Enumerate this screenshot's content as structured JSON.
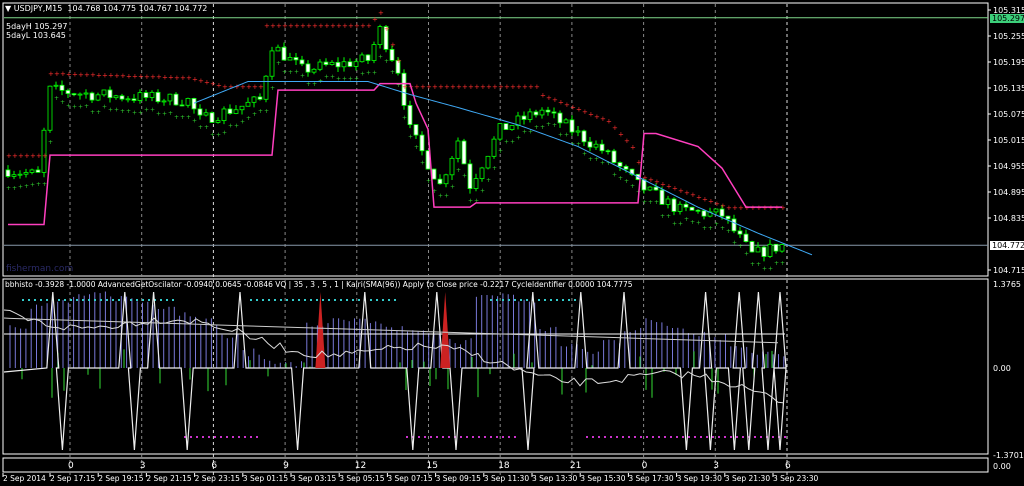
{
  "header": {
    "symbol": "USDJPY,M15",
    "ohlc": "104.768 104.775 104.767 104.772",
    "day_high": "5dayH 105.297",
    "day_low": "5dayL 103.645",
    "watermark": "fisherman.com"
  },
  "indicator_header": "bbhisto -0.3928 -1.0000  AdvancedGetOscilator -0.0940 0.0645 -0.0846  VQ | 35 , 3 , 5 , 1 |  Kairi(SMA(96)) Apply to Close price -0.2217  CycleIdentifier 0.0000 104.7775",
  "price_axis": [
    "105.315",
    "105.255",
    "105.195",
    "105.135",
    "105.075",
    "105.015",
    "104.955",
    "104.895",
    "104.835",
    "104.715"
  ],
  "price_axis_values": [
    105.315,
    105.255,
    105.195,
    105.135,
    105.075,
    105.015,
    104.955,
    104.895,
    104.835,
    104.715
  ],
  "price_tags": {
    "high": "105.297",
    "high_value": 105.297,
    "current": "104.772",
    "current_value": 104.772
  },
  "indicator_axis": {
    "top": "1.3765",
    "zero": "0.00",
    "bottom": "-1.3701",
    "cycle_scale": "0.00"
  },
  "cycle_labels": [
    "0",
    "3",
    "6",
    "9",
    "12",
    "15",
    "18",
    "21",
    "0",
    "3",
    "6"
  ],
  "time_labels": [
    "2 Sep 2014",
    "2 Sep 17:15",
    "2 Sep 19:15",
    "2 Sep 21:15",
    "2 Sep 23:15",
    "3 Sep 01:15",
    "3 Sep 03:15",
    "3 Sep 05:15",
    "3 Sep 07:15",
    "3 Sep 09:15",
    "3 Sep 11:30",
    "3 Sep 13:30",
    "3 Sep 15:30",
    "3 Sep 17:30",
    "3 Sep 19:30",
    "3 Sep 21:30",
    "3 Sep 23:30"
  ],
  "colors": {
    "bull": "#00ff00",
    "bear": "#ffffff",
    "wick": "#00ff00",
    "pink": "#ff3fbf",
    "ma": "#3fa9f5",
    "high_line": "#7fd88a",
    "hist": "#7878d8",
    "cyan": "#33cccc",
    "magenta": "#cc33cc",
    "spike_red": "#cc2222"
  },
  "price_path": [
    [
      0,
      104.946
    ],
    [
      5,
      104.934
    ],
    [
      7,
      105.13
    ],
    [
      15,
      105.119
    ],
    [
      30,
      105.107
    ],
    [
      32,
      105.061
    ],
    [
      42,
      105.107
    ],
    [
      44,
      105.234
    ],
    [
      49,
      105.177
    ],
    [
      60,
      105.2
    ],
    [
      62,
      105.269
    ],
    [
      65,
      105.177
    ],
    [
      67,
      105.038
    ],
    [
      72,
      104.911
    ],
    [
      75,
      105.015
    ],
    [
      77,
      104.911
    ],
    [
      82,
      105.038
    ],
    [
      89,
      105.084
    ],
    [
      99,
      104.992
    ],
    [
      105,
      104.911
    ],
    [
      112,
      104.853
    ],
    [
      119,
      104.842
    ],
    [
      124,
      104.75
    ],
    [
      129,
      104.772
    ]
  ],
  "upper_band": [
    [
      0,
      104.98
    ],
    [
      6,
      104.98
    ],
    [
      7,
      105.17
    ],
    [
      30,
      105.16
    ],
    [
      36,
      105.14
    ],
    [
      42,
      105.14
    ],
    [
      43,
      105.28
    ],
    [
      60,
      105.28
    ],
    [
      62,
      105.31
    ],
    [
      65,
      105.2
    ],
    [
      66,
      105.14
    ],
    [
      80,
      105.14
    ],
    [
      82,
      105.14
    ],
    [
      88,
      105.14
    ],
    [
      89,
      105.12
    ],
    [
      100,
      105.06
    ],
    [
      104,
      105.0
    ],
    [
      106,
      104.93
    ],
    [
      112,
      104.9
    ],
    [
      118,
      104.87
    ],
    [
      120,
      104.86
    ],
    [
      129,
      104.86
    ]
  ],
  "pink_step": [
    [
      0,
      104.82
    ],
    [
      6,
      104.82
    ],
    [
      7,
      104.98
    ],
    [
      44,
      104.98
    ],
    [
      45,
      105.13
    ],
    [
      61,
      105.13
    ],
    [
      62,
      105.145
    ],
    [
      67,
      105.145
    ],
    [
      68,
      105.1
    ],
    [
      70,
      105.04
    ],
    [
      71,
      104.86
    ],
    [
      77,
      104.86
    ],
    [
      78,
      104.87
    ],
    [
      105,
      104.87
    ],
    [
      106,
      105.03
    ],
    [
      108,
      105.03
    ],
    [
      115,
      105.0
    ],
    [
      119,
      104.95
    ],
    [
      123,
      104.86
    ],
    [
      129,
      104.86
    ]
  ],
  "ma_line": [
    [
      31,
      105.1
    ],
    [
      40,
      105.15
    ],
    [
      50,
      105.15
    ],
    [
      60,
      105.15
    ],
    [
      67,
      105.12
    ],
    [
      75,
      105.09
    ],
    [
      85,
      105.05
    ],
    [
      95,
      105.0
    ],
    [
      105,
      104.93
    ],
    [
      115,
      104.86
    ],
    [
      125,
      104.8
    ],
    [
      134,
      104.75
    ]
  ],
  "spikes_up": [
    11,
    26,
    32,
    50,
    76,
    91,
    111,
    121,
    130,
    147,
    154,
    158,
    163
  ],
  "spikes_red": [
    63,
    89
  ],
  "spikes_down": [
    13,
    28,
    39,
    62,
    86,
    95,
    110,
    143,
    148,
    153,
    156,
    160,
    166
  ],
  "histogram_top": [
    0.55,
    0.8,
    0.85,
    0.9,
    0.95,
    0.9,
    0.85,
    0.8,
    0.7,
    0.6,
    0.4,
    0.2,
    0.1,
    0.05,
    0.55,
    0.6,
    0.6,
    0.55,
    0.5,
    0.45,
    0.4,
    0.35,
    0.9,
    0.95,
    0.85,
    0.5,
    0.3,
    0.2,
    0.35,
    0.5,
    0.6,
    0.55,
    0.45,
    0.4,
    0.3,
    0.2,
    0.15
  ]
}
